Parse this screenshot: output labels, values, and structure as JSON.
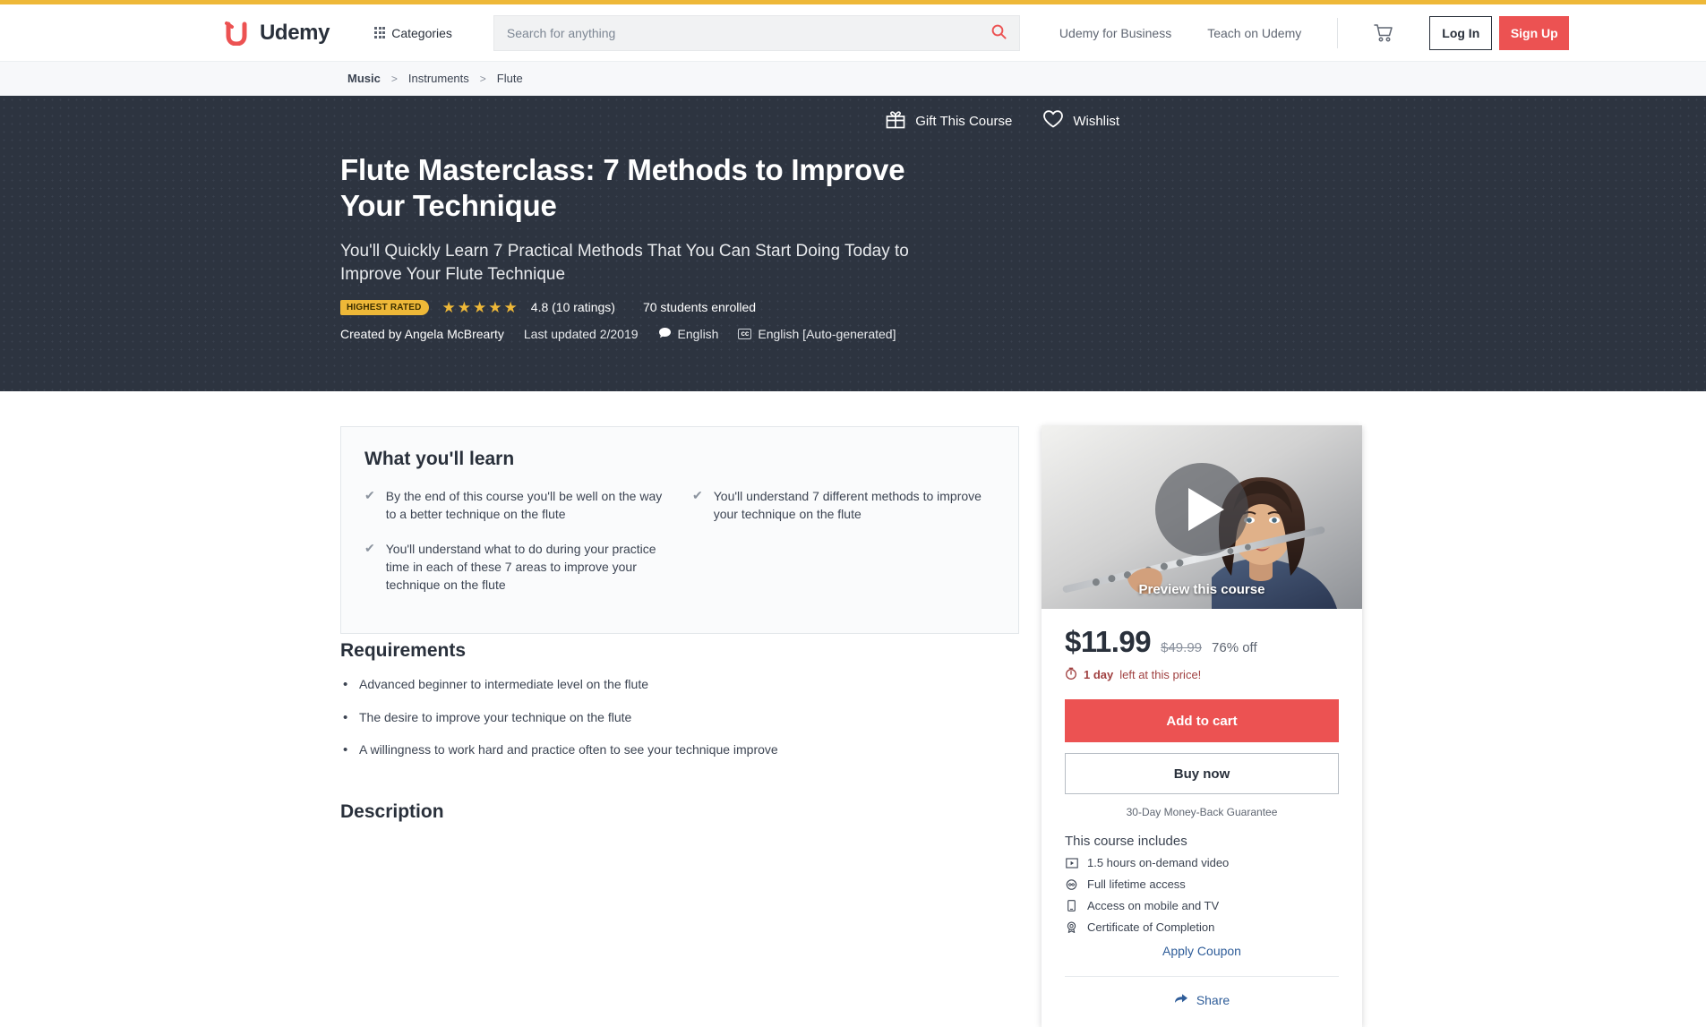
{
  "theme": {
    "accent_red": "#ec5252",
    "gold": "#eeb838",
    "hero_bg": "#2d3440",
    "link_blue": "#2f5d99",
    "text_dark": "#29303b"
  },
  "progress_bar": {
    "name": "page-loading-bar",
    "color": "#eeb838"
  },
  "header": {
    "logo_text": "Udemy",
    "logo_icon": "udemy-u-logo-icon",
    "categories_label": "Categories",
    "categories_icon": "grid-icon",
    "search": {
      "placeholder": "Search for anything",
      "value": "",
      "icon": "search-icon"
    },
    "nav_links": [
      {
        "label": "Udemy for Business"
      },
      {
        "label": "Teach on Udemy"
      }
    ],
    "cart_icon": "shopping-cart-icon",
    "login_label": "Log In",
    "signup_label": "Sign Up"
  },
  "breadcrumb": {
    "items": [
      {
        "label": "Music"
      },
      {
        "label": "Instruments"
      },
      {
        "label": "Flute"
      }
    ],
    "separator": ">"
  },
  "hero": {
    "gift_label": "Gift This Course",
    "gift_icon": "gift-icon",
    "wishlist_label": "Wishlist",
    "wishlist_icon": "heart-icon",
    "title": "Flute Masterclass: 7 Methods to Improve Your Technique",
    "subtitle": "You'll Quickly Learn 7 Practical Methods That You Can Start Doing Today to Improve Your Flute Technique",
    "badge": "HIGHEST RATED",
    "stars_filled": 5,
    "star_glyph": "★",
    "rating_text": "4.8 (10 ratings)",
    "enrolled_text": "70 students enrolled",
    "created_by": "Created by Angela McBrearty",
    "last_updated": "Last updated 2/2019",
    "language": "English",
    "language_icon": "speech-bubble-icon",
    "captions": "English [Auto-generated]",
    "captions_icon": "closed-caption-icon"
  },
  "what_you_learn": {
    "heading": "What you'll learn",
    "check_glyph": "✔",
    "items": [
      "By the end of this course you'll be well on the way to a better technique on the flute",
      "You'll understand 7 different methods to improve your technique on the flute",
      "You'll understand what to do during your practice time in each of these 7 areas to improve your technique on the flute"
    ]
  },
  "requirements": {
    "heading": "Requirements",
    "items": [
      "Advanced beginner to intermediate level on the flute",
      "The desire to improve your technique on the flute",
      "A willingness to work hard and practice often to see your technique improve"
    ]
  },
  "description": {
    "heading": "Description"
  },
  "sidebar": {
    "preview_label": "Preview this course",
    "play_icon": "play-button-icon",
    "thumbnail_alt": "flutist-holding-flute-photo",
    "price_current": "$11.99",
    "price_original": "$49.99",
    "discount": "76% off",
    "deadline_icon": "stopwatch-icon",
    "deadline_bold": "1 day",
    "deadline_rest": "left at this price!",
    "add_to_cart_label": "Add to cart",
    "buy_now_label": "Buy now",
    "guarantee": "30-Day Money-Back Guarantee",
    "includes_heading": "This course includes",
    "includes": [
      {
        "icon": "video-icon",
        "glyph": "▣",
        "label": "1.5 hours on-demand video"
      },
      {
        "icon": "infinity-icon",
        "glyph": "✇",
        "label": "Full lifetime access"
      },
      {
        "icon": "mobile-icon",
        "glyph": "▯",
        "label": "Access on mobile and TV"
      },
      {
        "icon": "certificate-icon",
        "glyph": "❁",
        "label": "Certificate of Completion"
      }
    ],
    "coupon_label": "Apply Coupon",
    "share_label": "Share",
    "share_icon": "share-arrow-icon"
  }
}
